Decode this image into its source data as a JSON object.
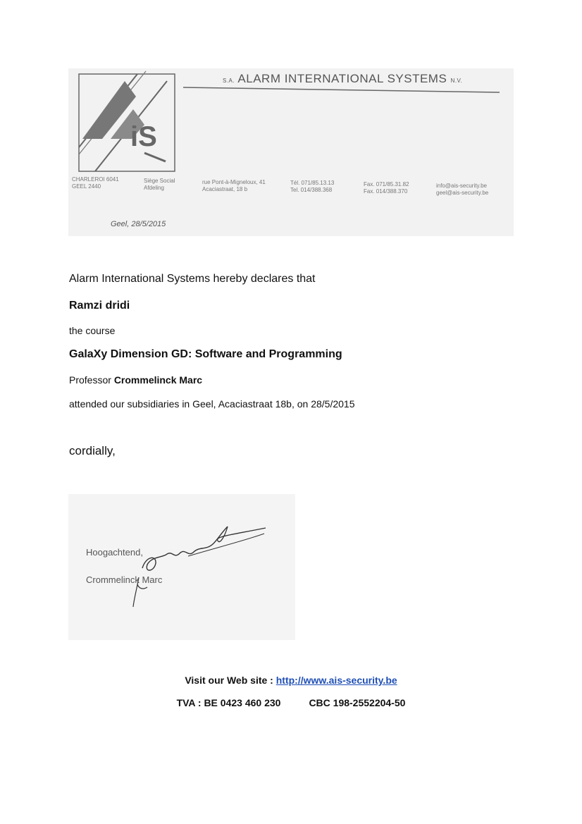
{
  "letterhead": {
    "company_prefix": "S.A.",
    "company_name": "ALARM INTERNATIONAL SYSTEMS",
    "company_suffix": "N.V.",
    "city1": "CHARLEROI 6041",
    "city2": "GEEL 2440",
    "office1": "Siège Social",
    "office2": "Afdeling",
    "street1": "rue Pont-à-Migneloux, 41",
    "street2": "Acaciastraat, 18 b",
    "tel1": "Tél. 071/85.13.13",
    "tel2": "Tel. 014/388.368",
    "fax1": "Fax. 071/85.31.82",
    "fax2": "Fax. 014/388.370",
    "email1": "info@ais-security.be",
    "email2": "geel@ais-security.be",
    "date": "Geel, 28/5/2015"
  },
  "content": {
    "declaration": "Alarm International Systems hereby declares that",
    "name": "Ramzi dridi",
    "course_label": "the course",
    "course_title": "GalaXy Dimension GD: Software and Programming",
    "professor_label": "Professor",
    "professor_name": "Crommelinck Marc",
    "attended": "attended our subsidiaries in Geel, Acaciastraat 18b, on 28/5/2015",
    "closing": "cordially,"
  },
  "signature": {
    "greeting": "Hoogachtend,",
    "signer": "Crommelinck Marc"
  },
  "footer": {
    "web_label": "Visit our Web site :",
    "web_link": "http://www.ais-security.be",
    "tva": "TVA : BE 0423 460 230",
    "cbc": "CBC  198-2552204-50"
  },
  "colors": {
    "link": "#1f4fb5",
    "logo_gray": "#666666"
  }
}
